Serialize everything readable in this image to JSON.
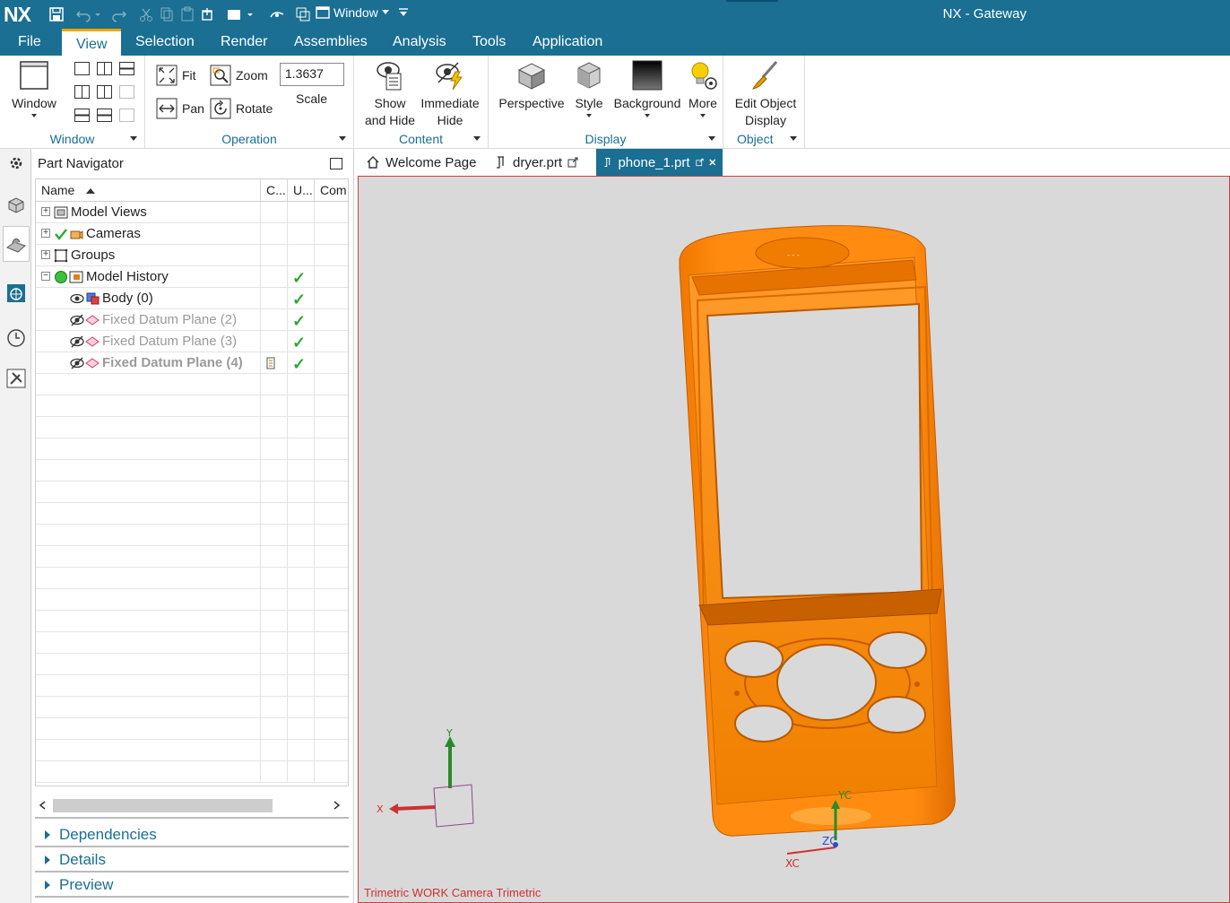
{
  "titlebar": {
    "logo": "NX",
    "window_menu": "Window",
    "app_title": "NX - Gateway"
  },
  "menubar": {
    "items": [
      "File",
      "View",
      "Selection",
      "Render",
      "Assemblies",
      "Analysis",
      "Tools",
      "Application"
    ],
    "active": "View"
  },
  "ribbon": {
    "window_group": {
      "button": "Window",
      "label": "Window"
    },
    "operation_group": {
      "fit": "Fit",
      "zoom": "Zoom",
      "pan": "Pan",
      "rotate": "Rotate",
      "scale_value": "1.3637",
      "scale_label": "Scale",
      "label": "Operation"
    },
    "content_group": {
      "show_hide_l1": "Show",
      "show_hide_l2": "and Hide",
      "immediate_l1": "Immediate",
      "immediate_l2": "Hide",
      "label": "Content"
    },
    "display_group": {
      "perspective": "Perspective",
      "style": "Style",
      "background": "Background",
      "more": "More",
      "label": "Display"
    },
    "object_group": {
      "edit_l1": "Edit Object",
      "edit_l2": "Display",
      "label": "Object"
    }
  },
  "part_navigator": {
    "title": "Part Navigator",
    "columns": {
      "name": "Name",
      "c": "C...",
      "u": "U...",
      "comment": "Com"
    },
    "rows": [
      {
        "label": "Model Views"
      },
      {
        "label": "Cameras"
      },
      {
        "label": "Groups"
      },
      {
        "label": "Model History"
      },
      {
        "label": "Body (0)"
      },
      {
        "label": "Fixed Datum Plane (2)"
      },
      {
        "label": "Fixed Datum Plane (3)"
      },
      {
        "label": "Fixed Datum Plane (4)"
      }
    ],
    "subpanels": [
      "Dependencies",
      "Details",
      "Preview"
    ]
  },
  "tabs": [
    {
      "label": "Welcome Page"
    },
    {
      "label": "dryer.prt"
    },
    {
      "label": "phone_1.prt"
    }
  ],
  "viewport": {
    "view_label": "Trimetric WORK Camera Trimetric",
    "triad": {
      "x": "X",
      "y": "Y"
    },
    "wcs": {
      "xc": "XC",
      "yc": "YC",
      "zc": "ZC"
    }
  },
  "colors": {
    "accent": "#1a6f92",
    "model": "#ff8c10",
    "viewport_bg": "#d9d9d9",
    "check": "#2ea82e"
  }
}
